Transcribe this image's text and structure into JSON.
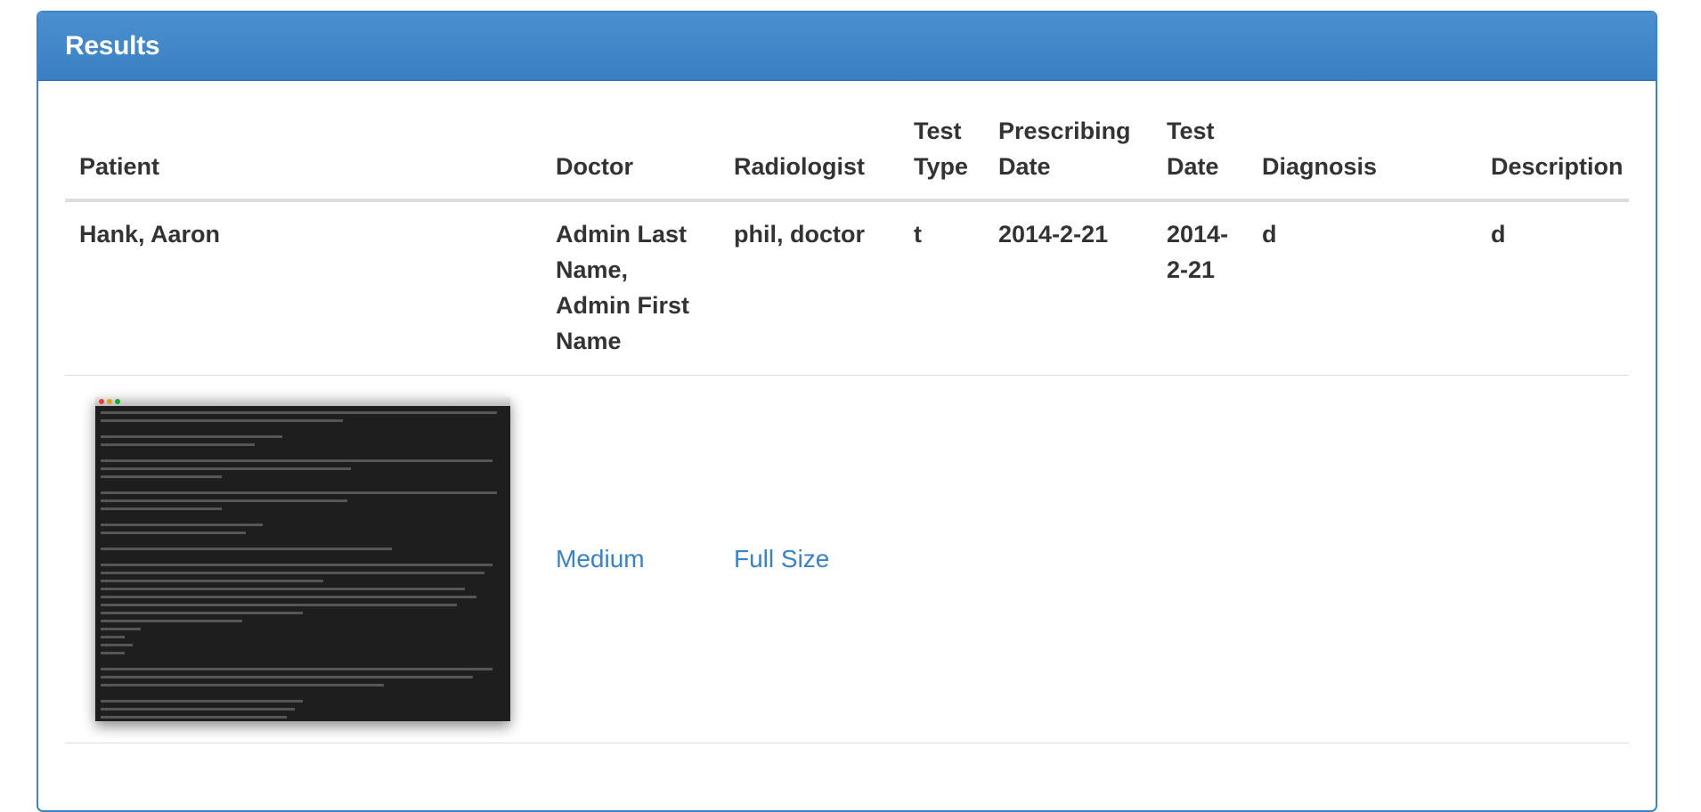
{
  "panel": {
    "title": "Results"
  },
  "table": {
    "headers": {
      "patient": "Patient",
      "doctor": "Doctor",
      "radiologist": "Radiologist",
      "test_type": "Test Type",
      "prescribing_date": "Prescribing Date",
      "test_date": "Test Date",
      "diagnosis": "Diagnosis",
      "description": "Description"
    },
    "rows": [
      {
        "patient": "Hank, Aaron",
        "doctor": "Admin Last Name, Admin First Name",
        "radiologist": "phil, doctor",
        "test_type": "t",
        "prescribing_date": "2014-2-21",
        "test_date": "2014-2-21",
        "diagnosis": "d",
        "description": "d"
      }
    ],
    "image_links": {
      "medium": "Medium",
      "full_size": "Full Size"
    }
  },
  "colors": {
    "panel_header": "#3c84c6",
    "link": "#3a82c4",
    "text": "#333333"
  }
}
